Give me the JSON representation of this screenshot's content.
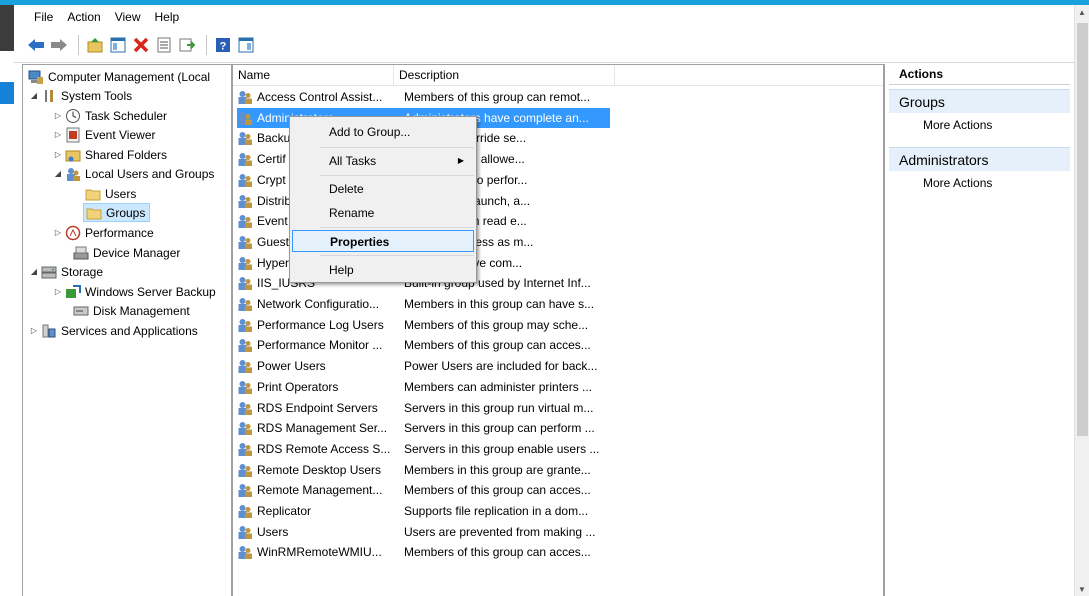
{
  "menu": [
    "File",
    "Action",
    "View",
    "Help"
  ],
  "toolbar": {
    "icons": [
      "back-arrow-icon",
      "forward-arrow-icon",
      "up-folder-icon",
      "show-hide-tree-icon",
      "delete-icon",
      "properties-icon",
      "export-list-icon",
      "help-icon",
      "console-tree-icon"
    ]
  },
  "tree": {
    "root": "Computer Management (Local",
    "system_tools": "System Tools",
    "task_scheduler": "Task Scheduler",
    "event_viewer": "Event Viewer",
    "shared_folders": "Shared Folders",
    "local_users_groups": "Local Users and Groups",
    "users": "Users",
    "groups": "Groups",
    "performance": "Performance",
    "device_manager": "Device Manager",
    "storage": "Storage",
    "windows_server_backup": "Windows Server Backup",
    "disk_management": "Disk Management",
    "services_apps": "Services and Applications"
  },
  "list": {
    "col_name": "Name",
    "col_desc": "Description",
    "rows": [
      {
        "name": "Access Control Assist...",
        "desc": "Members of this group can remot..."
      },
      {
        "name": "Administrators",
        "desc": "Administrators have complete an..."
      },
      {
        "name": "Backu",
        "desc": "ators can override se..."
      },
      {
        "name": "Certif",
        "desc": "this group are allowe..."
      },
      {
        "name": "Crypt",
        "desc": "e authorized to perfor..."
      },
      {
        "name": "Distrib",
        "desc": "e allowed to launch, a..."
      },
      {
        "name": "Event",
        "desc": "this group can read e..."
      },
      {
        "name": "Guest",
        "desc": "the same access as m..."
      },
      {
        "name": "Hyper",
        "desc": "this group have com..."
      },
      {
        "name": "IIS_IUSRS",
        "desc": "Built-in group used by Internet Inf..."
      },
      {
        "name": "Network Configuratio...",
        "desc": "Members in this group can have s..."
      },
      {
        "name": "Performance Log Users",
        "desc": "Members of this group may sche..."
      },
      {
        "name": "Performance Monitor ...",
        "desc": "Members of this group can acces..."
      },
      {
        "name": "Power Users",
        "desc": "Power Users are included for back..."
      },
      {
        "name": "Print Operators",
        "desc": "Members can administer printers ..."
      },
      {
        "name": "RDS Endpoint Servers",
        "desc": "Servers in this group run virtual m..."
      },
      {
        "name": "RDS Management Ser...",
        "desc": "Servers in this group can perform ..."
      },
      {
        "name": "RDS Remote Access S...",
        "desc": "Servers in this group enable users ..."
      },
      {
        "name": "Remote Desktop Users",
        "desc": "Members in this group are grante..."
      },
      {
        "name": "Remote Management...",
        "desc": "Members of this group can acces..."
      },
      {
        "name": "Replicator",
        "desc": "Supports file replication in a dom..."
      },
      {
        "name": "Users",
        "desc": "Users are prevented from making ..."
      },
      {
        "name": "WinRMRemoteWMIU...",
        "desc": "Members of this group can acces..."
      }
    ]
  },
  "actions": {
    "header": "Actions",
    "section1": "Groups",
    "section1_item": "More Actions",
    "section2": "Administrators",
    "section2_item": "More Actions"
  },
  "context_menu": {
    "add_to_group": "Add to Group...",
    "all_tasks": "All Tasks",
    "delete": "Delete",
    "rename": "Rename",
    "properties": "Properties",
    "help": "Help"
  },
  "colors": {
    "selection": "#3399ff",
    "title_strip": "#1aa0dd",
    "action_section": "#e6f0fa"
  }
}
